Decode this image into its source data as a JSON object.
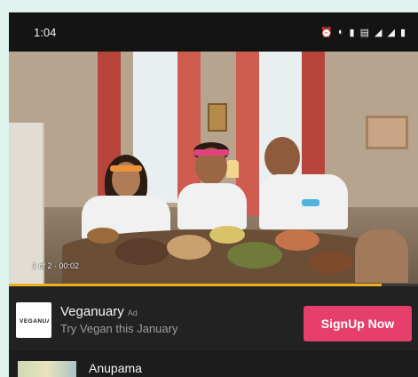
{
  "status_bar": {
    "time": "1:04",
    "icons": [
      "alarm-icon",
      "data-saver-icon",
      "vibrate-icon",
      "volte-icon",
      "signal-icon",
      "signal-icon",
      "battery-icon"
    ]
  },
  "video": {
    "counter": "1 of 2 · 00:02",
    "progress_fraction": 0.91,
    "colors": {
      "progress": "#e7b21d"
    }
  },
  "ad": {
    "logo_text": "VEGANUARY",
    "title": "Veganuary",
    "tag": "Ad",
    "subtitle": "Try Vegan this January",
    "cta_label": "SignUp Now",
    "colors": {
      "cta": "#e63f6c"
    }
  },
  "next_item": {
    "title": "Anupama"
  }
}
